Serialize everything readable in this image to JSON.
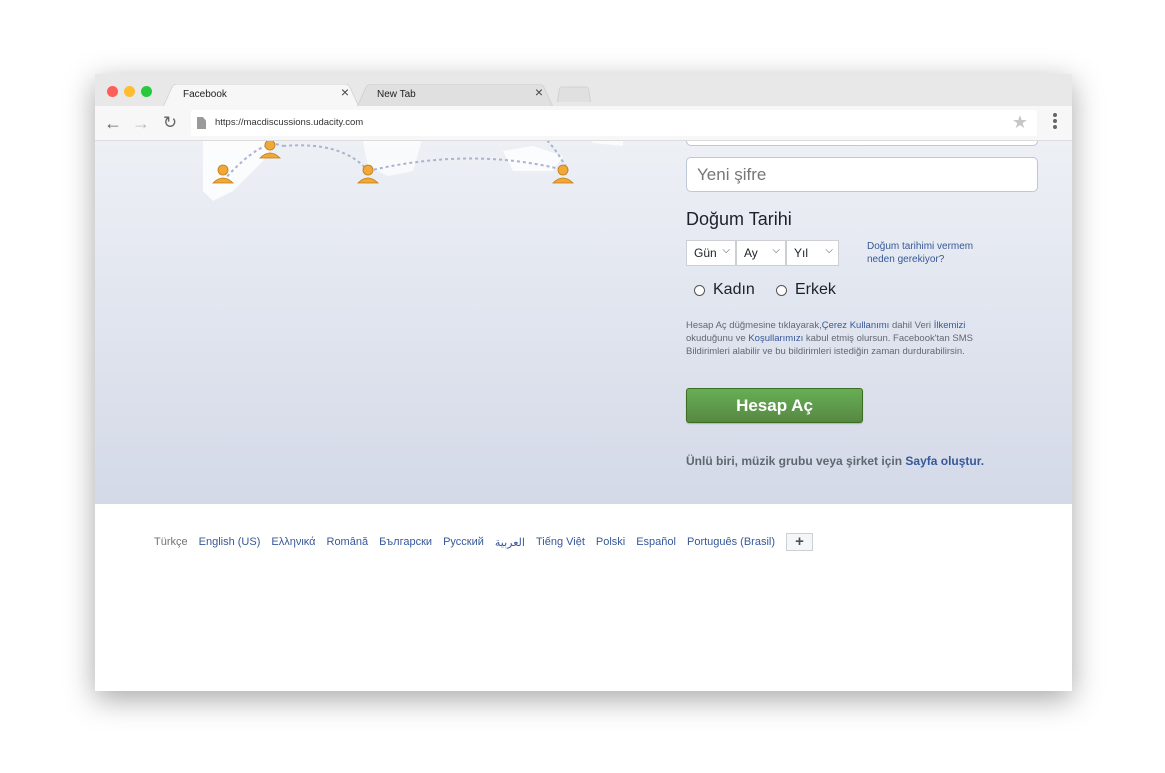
{
  "browser": {
    "tabs": [
      {
        "title": "Facebook",
        "close": "×"
      },
      {
        "title": "New Tab",
        "close": "×"
      }
    ],
    "url": "https://macdiscussions.udacity.com"
  },
  "form": {
    "new_password_placeholder": "Yeni şifre",
    "dob_title": "Doğum Tarihi",
    "day_label": "Gün",
    "month_label": "Ay",
    "year_label": "Yıl",
    "why_dob": "Doğum tarihimi vermem neden gerekiyor?",
    "gender_female": "Kadın",
    "gender_male": "Erkek",
    "terms": {
      "part1": "Hesap Aç düğmesine tıklayarak,",
      "link_cookies": "Çerez Kullanımı",
      "part2": " dahil Veri ",
      "link_policy": "İlkemizi",
      "part3": " okuduğunu ve ",
      "link_terms": "Koşullarımızı",
      "part4": " kabul etmiş olursun. Facebook'tan SMS Bildirimleri alabilir ve bu bildirimleri istediğin zaman durdurabilirsin."
    },
    "signup_button": "Hesap Aç",
    "create_page_text": "Ünlü biri, müzik grubu veya şirket için ",
    "create_page_link": "Sayfa oluştur."
  },
  "footer": {
    "languages": [
      "Türkçe",
      "English (US)",
      "Ελληνικά",
      "Română",
      "Български",
      "Русский",
      "العربية",
      "Tiếng Việt",
      "Polski",
      "Español",
      "Português (Brasil)"
    ],
    "more": "+"
  },
  "colors": {
    "link": "#365899",
    "signup_green": "#5b9a48"
  }
}
